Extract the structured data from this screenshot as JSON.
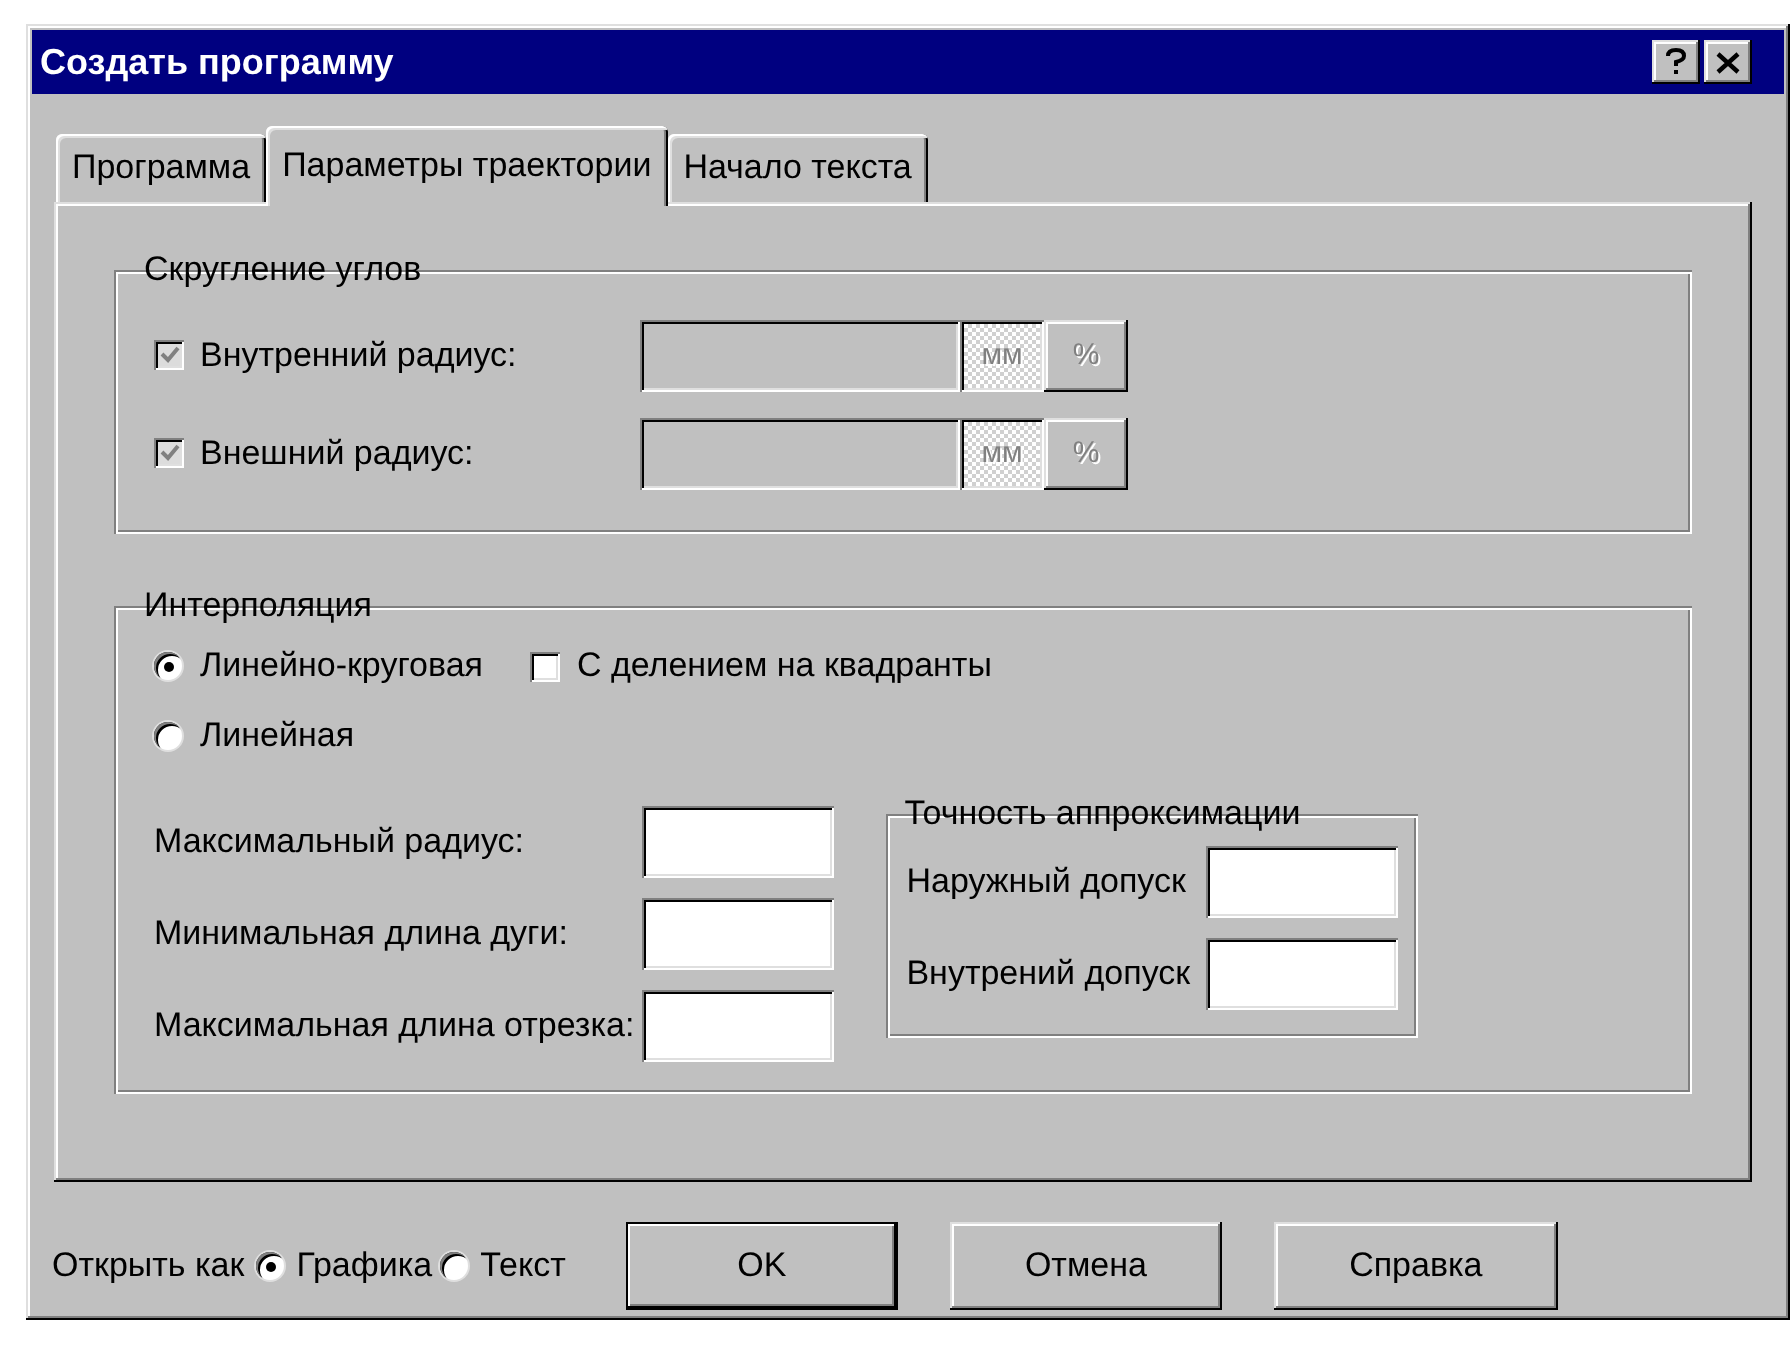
{
  "window": {
    "title": "Создать программу"
  },
  "tabs": [
    {
      "label": "Программа",
      "selected": false
    },
    {
      "label": "Параметры траектории",
      "selected": true
    },
    {
      "label": "Начало текста",
      "selected": false
    }
  ],
  "corner_rounding": {
    "title": "Скругление углов",
    "rows": [
      {
        "label": "Внутренний радиус:",
        "checked": true,
        "disabled": true,
        "units": [
          {
            "label": "мм",
            "selected": true,
            "disabled": true
          },
          {
            "label": "%",
            "selected": false,
            "disabled": true
          }
        ]
      },
      {
        "label": "Внешний радиус:",
        "checked": true,
        "disabled": true,
        "units": [
          {
            "label": "мм",
            "selected": true,
            "disabled": true
          },
          {
            "label": "%",
            "selected": false,
            "disabled": true
          }
        ]
      }
    ]
  },
  "interpolation": {
    "title": "Интерполяция",
    "modes": [
      {
        "label": "Линейно-круговая",
        "selected": true
      },
      {
        "label": "Линейная",
        "selected": false
      }
    ],
    "quadrants": {
      "label": "С делением на квадранты",
      "checked": false
    },
    "fields": [
      {
        "label": "Максимальный радиус:"
      },
      {
        "label": "Минимальная длина дуги:"
      },
      {
        "label": "Максимальная длина отрезка:"
      }
    ],
    "accuracy": {
      "title": "Точность аппроксимации",
      "fields": [
        {
          "label": "Наружный допуск"
        },
        {
          "label": "Внутрений допуск"
        }
      ]
    }
  },
  "open_as": {
    "label": "Открыть как",
    "options": [
      {
        "label": "Графика",
        "selected": true
      },
      {
        "label": "Текст",
        "selected": false
      }
    ]
  },
  "buttons": [
    {
      "label": "OK",
      "default": true
    },
    {
      "label": "Отмена",
      "default": false
    },
    {
      "label": "Справка",
      "default": false
    }
  ]
}
